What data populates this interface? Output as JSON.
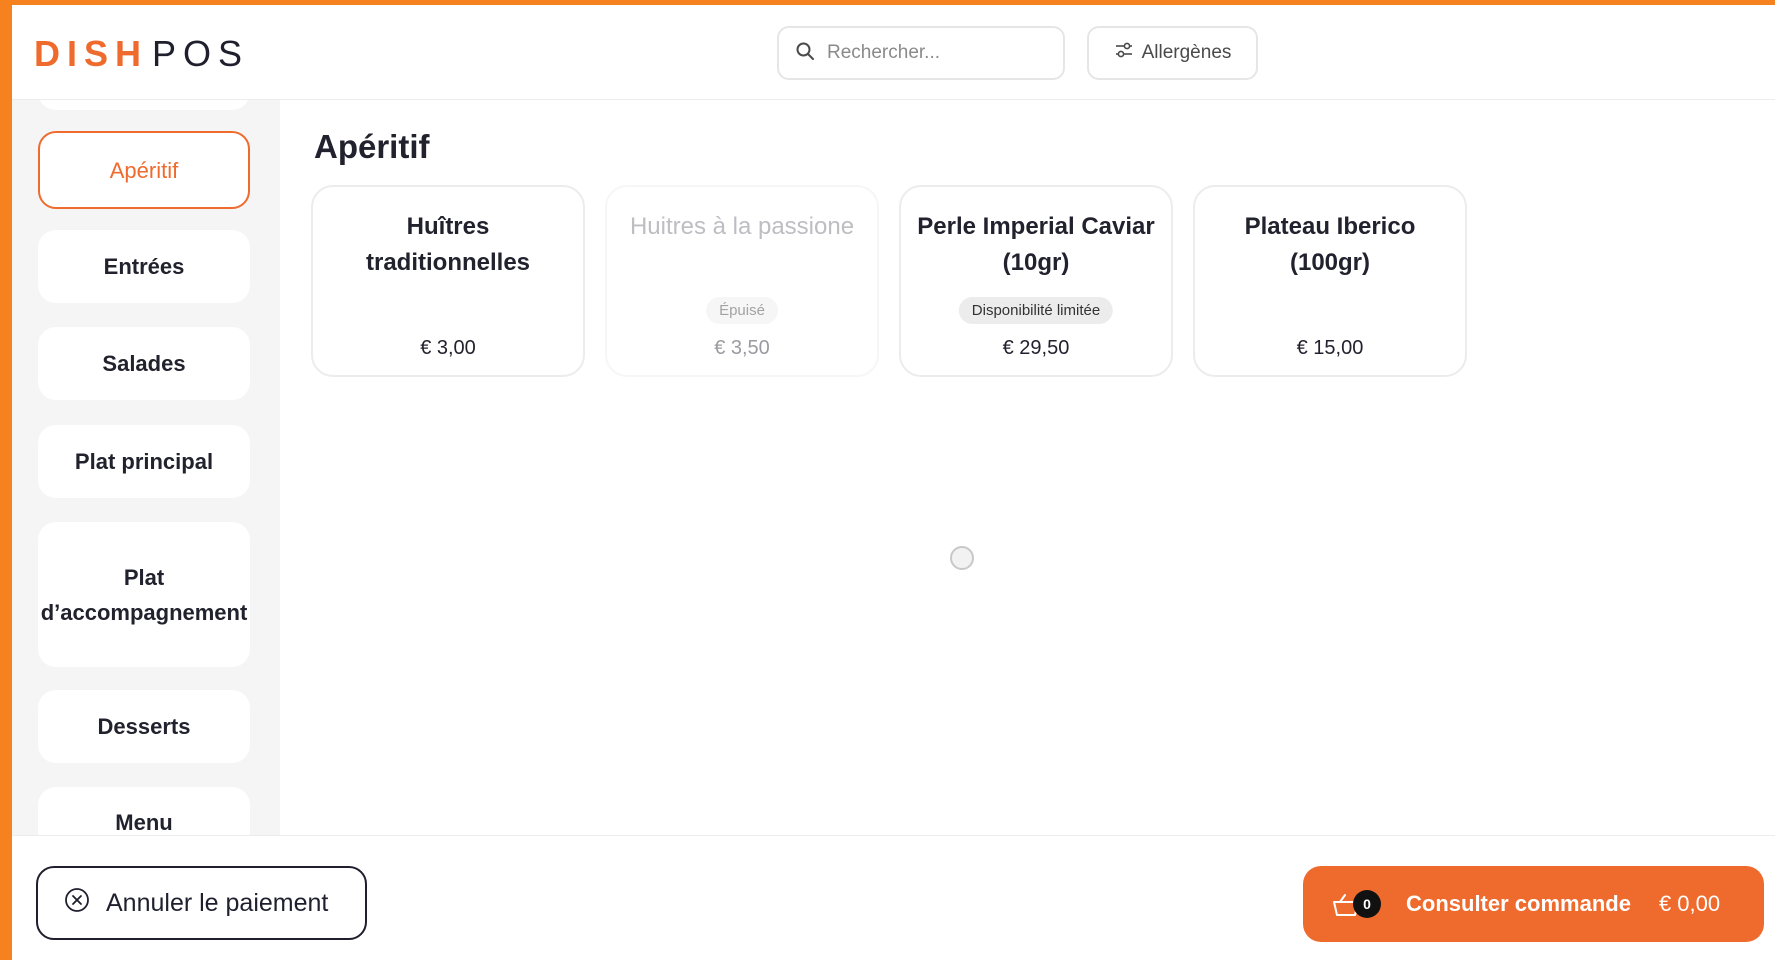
{
  "colors": {
    "accent": "#ef6a2d",
    "frame": "#f5821f",
    "sidebar_bg": "#f5f5f6"
  },
  "header": {
    "logo_brand": "DISH",
    "logo_suffix": "POS",
    "search": {
      "placeholder": "Rechercher...",
      "icon": "search-icon"
    },
    "allergens": {
      "label": "Allergènes",
      "icon": "sliders-icon"
    }
  },
  "sidebar": {
    "items": [
      {
        "label": "Apéritif",
        "active": true
      },
      {
        "label": "Entrées"
      },
      {
        "label": "Salades"
      },
      {
        "label": "Plat principal"
      },
      {
        "label": "Plat d’accompagnement"
      },
      {
        "label": "Desserts"
      },
      {
        "label": "Menu"
      }
    ]
  },
  "main": {
    "title": "Apéritif",
    "products": [
      {
        "name": "Huîtres traditionnelles",
        "price": "€ 3,00",
        "badge": "",
        "available": true
      },
      {
        "name": "Huitres à la passione",
        "price": "€ 3,50",
        "badge": "Épuisé",
        "available": false
      },
      {
        "name": "Perle Imperial Caviar (10gr)",
        "price": "€ 29,50",
        "badge": "Disponibilité limitée",
        "available": true
      },
      {
        "name": "Plateau Iberico (100gr)",
        "price": "€ 15,00",
        "badge": "",
        "available": true
      }
    ]
  },
  "footer": {
    "cancel": {
      "label": "Annuler le paiement",
      "icon": "close-circle-icon"
    },
    "order": {
      "label": "Consulter commande",
      "total": "€ 0,00",
      "count": "0",
      "icon": "basket-icon"
    }
  }
}
